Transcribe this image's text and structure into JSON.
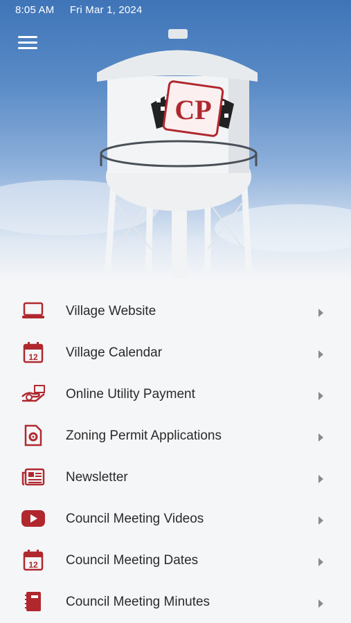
{
  "status_bar": {
    "time": "8:05 AM",
    "date": "Fri Mar 1, 2024"
  },
  "hero": {
    "tower_logo_text": "CP"
  },
  "accent_color": "#b0282e",
  "menu": [
    {
      "label": "Village Website",
      "icon": "laptop-icon"
    },
    {
      "label": "Village Calendar",
      "icon": "calendar-icon"
    },
    {
      "label": "Online Utility Payment",
      "icon": "payment-hand-icon"
    },
    {
      "label": "Zoning Permit Applications",
      "icon": "document-gear-icon"
    },
    {
      "label": "Newsletter",
      "icon": "newspaper-icon"
    },
    {
      "label": "Council Meeting Videos",
      "icon": "youtube-icon"
    },
    {
      "label": "Council Meeting Dates",
      "icon": "calendar-icon"
    },
    {
      "label": "Council Meeting Minutes",
      "icon": "notebook-icon"
    }
  ],
  "calendar_icon_number": "12"
}
